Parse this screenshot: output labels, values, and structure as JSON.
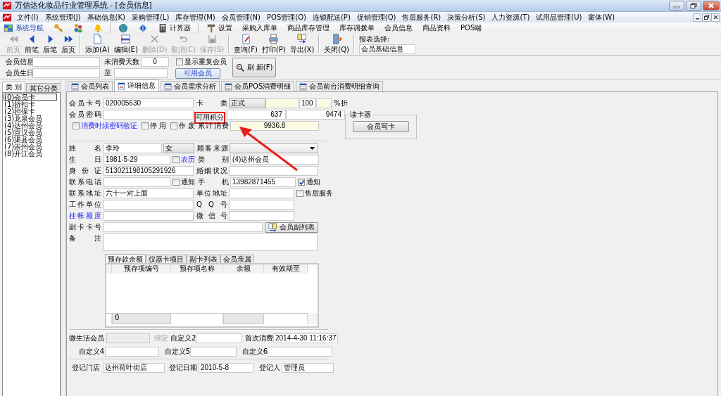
{
  "window": {
    "title": "万信达化妆品行业管理系统 - [会员信息]"
  },
  "menu": [
    "文件(I)",
    "系统管理(J)",
    "基础信息(K)",
    "采购管理(L)",
    "库存管理(M)",
    "会员管理(N)",
    "POS管理(O)",
    "连锁配送(P)",
    "促销管理(Q)",
    "售后服务(R)",
    "决策分析(S)",
    "人力资源(T)",
    "试用品管理(U)",
    "窗体(W)"
  ],
  "quick_bar": [
    {
      "kind": "nav",
      "label": "系统导航"
    },
    {
      "kind": "key"
    },
    {
      "kind": "people"
    },
    {
      "kind": "bell"
    },
    {
      "kind": "separator"
    },
    {
      "kind": "globe"
    },
    {
      "kind": "info"
    },
    {
      "kind": "calculator",
      "label": "计算器"
    },
    {
      "kind": "separator"
    },
    {
      "kind": "tool",
      "label": "设置"
    },
    {
      "kind": "text",
      "label": "采购入库单"
    },
    {
      "kind": "text",
      "label": "商品库存管理"
    },
    {
      "kind": "text",
      "label": "库存调拨单"
    },
    {
      "kind": "text",
      "label": "会员信息"
    },
    {
      "kind": "text",
      "label": "商品资料"
    },
    {
      "kind": "text",
      "label": "POS端"
    }
  ],
  "toolbar": [
    {
      "kind": "first",
      "label": "前页",
      "disabled": true
    },
    {
      "kind": "prev",
      "label": "前笔",
      "disabled": false
    },
    {
      "kind": "next",
      "label": "后笔",
      "disabled": false
    },
    {
      "kind": "last",
      "label": "后页",
      "disabled": false
    },
    {
      "kind": "separator"
    },
    {
      "kind": "add",
      "label": "添加(A)",
      "disabled": false
    },
    {
      "kind": "edit",
      "label": "编辑(E)",
      "disabled": false
    },
    {
      "kind": "delete",
      "label": "删除(D)",
      "disabled": true
    },
    {
      "kind": "cancel",
      "label": "取消(C)",
      "disabled": true
    },
    {
      "kind": "save",
      "label": "保存(S)",
      "disabled": true
    },
    {
      "kind": "separator"
    },
    {
      "kind": "query",
      "label": "查询(F)",
      "disabled": false
    },
    {
      "kind": "print",
      "label": "打印(P)",
      "disabled": false
    },
    {
      "kind": "export",
      "label": "导出(X)",
      "disabled": false
    },
    {
      "kind": "separator"
    },
    {
      "kind": "close",
      "label": "关闭(Q)",
      "disabled": false
    }
  ],
  "report_select": {
    "label": "报表选择:",
    "value": "会员基础信息"
  },
  "filter": {
    "member_info": {
      "label": "会员信息"
    },
    "idle_days": {
      "label": "未消费天数",
      "value": "0"
    },
    "show_duplicates": {
      "label": "显示重复会员",
      "checked": false
    },
    "birthday_from": {
      "label": "会员生日"
    },
    "birthday_to": {
      "label": "至"
    },
    "available_button": "可用会员",
    "refresh_button": "刷  新(F)"
  },
  "side_tabs": [
    {
      "label": "类 别",
      "selected": true
    },
    {
      "label": "其它分类",
      "selected": false
    }
  ],
  "categories": [
    {
      "label": "(0)会员卡",
      "selected": true
    },
    {
      "label": "(1)折扣卡",
      "selected": false
    },
    {
      "label": "(2)担保卡",
      "selected": false
    },
    {
      "label": "(3)龙泉会员",
      "selected": false
    },
    {
      "label": "(4)达州会员",
      "selected": false
    },
    {
      "label": "(5)宣汉会员",
      "selected": false
    },
    {
      "label": "(6)渠县会员",
      "selected": false
    },
    {
      "label": "(7)崇州会员",
      "selected": false
    },
    {
      "label": "(8)开江会员",
      "selected": false
    }
  ],
  "tabs": [
    {
      "label": "会员列表",
      "selected": false
    },
    {
      "label": "详细信息",
      "selected": true
    },
    {
      "label": "会员需求分析",
      "selected": false
    },
    {
      "label": "会员POS消费明细",
      "selected": false
    },
    {
      "label": "会员前台消费明细查询",
      "selected": false
    }
  ],
  "card": {
    "card_no": {
      "label": "会员卡号",
      "value": "020005630"
    },
    "card_type": {
      "label": "卡 类",
      "value": "正式",
      "discount": "100",
      "unit": "%折"
    },
    "password": {
      "label": "会员密码"
    },
    "points": {
      "label": "可用积分",
      "available": "637",
      "total": "9474"
    },
    "spent": {
      "label": "累计消费",
      "value": "9936.8"
    },
    "checks": [
      {
        "label": "消费时须密码验证",
        "checked": false,
        "link": true
      },
      {
        "label": "停 用",
        "checked": false,
        "link": false
      },
      {
        "label": "作 废",
        "checked": false,
        "link": false
      }
    ]
  },
  "card_reader": {
    "title": "读卡器",
    "button": "会员写卡"
  },
  "person": {
    "name": {
      "label": "姓 名",
      "value": "李玲"
    },
    "gender": "女",
    "source": {
      "label": "顾客来源"
    },
    "birthday": {
      "label": "生 日",
      "value": "1981-5-29"
    },
    "lunar": {
      "label": "农历",
      "checked": false,
      "link": true
    },
    "category": {
      "label": "类 别",
      "value": "(4)达州会员"
    },
    "id_card": {
      "label": "身 份 证",
      "value": "513021198105291926"
    },
    "marital": {
      "label": "婚姻状况"
    },
    "phone": {
      "label": "联系电话"
    },
    "phone_notify": {
      "label": "通知",
      "checked": false
    },
    "mobile": {
      "label": "手 机",
      "value": "13982871455"
    },
    "mobile_notify": {
      "label": "通知",
      "checked": true
    },
    "address": {
      "label": "联系地址",
      "value": "六十一对上面"
    },
    "work_address": {
      "label": "单位地址"
    },
    "after_sales": {
      "label": "售后服务",
      "checked": false
    },
    "employer": {
      "label": "工作单位"
    },
    "qq": {
      "label": "Q Q 号"
    },
    "credit_limit": {
      "label": "挂帐额度",
      "link": true
    },
    "wechat": {
      "label": "微信号"
    },
    "sub_card": {
      "label": "副卡卡号"
    },
    "sub_card_button": "会员副列表",
    "note": {
      "label": "备 注"
    }
  },
  "sub_tabs": [
    {
      "label": "预存款余额",
      "selected": true
    },
    {
      "label": "仪器卡项目",
      "selected": false
    },
    {
      "label": "副卡列表",
      "selected": false
    },
    {
      "label": "会员亲属",
      "selected": false
    }
  ],
  "balance_table": {
    "columns": [
      "预存项编号",
      "预存项名称",
      "余额",
      "有效期至"
    ],
    "footer": "0"
  },
  "extra": {
    "wechat_member": {
      "label": "微生活会员",
      "disabled": true
    },
    "bind": {
      "label": "绑定",
      "disabled": true
    },
    "custom2": {
      "label": "自定义2"
    },
    "first_spend": {
      "label": "首次消费",
      "value": "2014-4-30 11:16:37"
    },
    "custom4": {
      "label": "自定义4"
    },
    "custom5": {
      "label": "自定义5"
    },
    "custom6": {
      "label": "自定义6"
    }
  },
  "registration": {
    "store": {
      "label": "登记门店",
      "value": "达州荷叶街店"
    },
    "date": {
      "label": "登记日期",
      "value": "2010-5-8"
    },
    "registrar": {
      "label": "登记人",
      "value": "管理员"
    }
  }
}
